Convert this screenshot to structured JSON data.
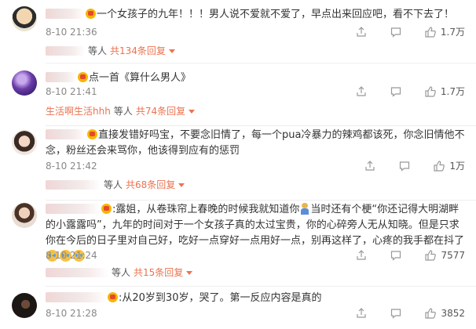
{
  "colors": {
    "accent": "#eb7350",
    "meta": "#888888",
    "text": "#333333",
    "divider": "#eeeeee"
  },
  "icons": {
    "share": "share-icon",
    "comment": "comment-icon",
    "like": "like-icon",
    "vip": "vip-badge-icon"
  },
  "comments": [
    {
      "text": "一个女孩子的九年！！！男人说不爱就不爱了，早点出来回应吧，看不下去了！",
      "time": "8-10 21:36",
      "likes": "1.7万",
      "reply_users": "等人",
      "reply_link": "共134条回复"
    },
    {
      "text": "点一首《算什么男人》",
      "time": "8-10 21:41",
      "likes": "1.7万",
      "reply_name": "生活啊生活hhh",
      "reply_users": "等人",
      "reply_link": "共74条回复"
    },
    {
      "text": "直接发错好吗宝，不要念旧情了，每一个pua冷暴力的辣鸡都该死，你念旧情他不念，粉丝还会来骂你，他该得到应有的惩罚",
      "time": "8-10 21:42",
      "likes": "1万",
      "reply_users": "等人",
      "reply_link": "共68条回复"
    },
    {
      "text_a": ":露姐，从卷珠帘上春晚的时候我就知道你",
      "text_b": "当时还有个梗“你还记得大明湖畔的小露露吗”，九年的时间对于一个女孩子真的太过宝贵，你的心碎旁人无从知晓。但是只求你在今后的日子里对自己好，吃好一点穿好一点用好一点，别再这样了，心疼的我手都在抖了",
      "time": "8-10 21:24",
      "likes": "7577",
      "reply_users": "等人",
      "reply_link": "共15条回复"
    },
    {
      "text": ":从20岁到30岁，哭了。第一反应内容是真的",
      "time": "8-10 21:28",
      "likes": "3852"
    }
  ]
}
